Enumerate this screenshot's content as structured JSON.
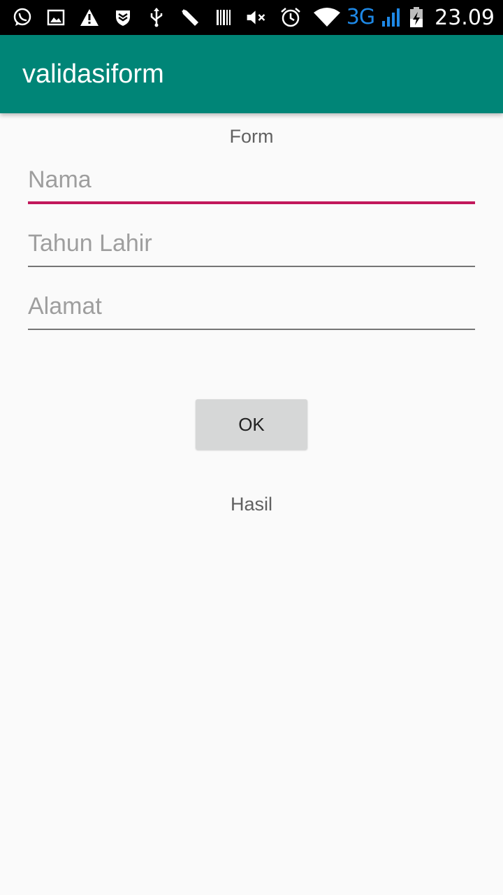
{
  "status_bar": {
    "time": "23.09",
    "network": "3G",
    "icons": [
      "whatsapp-icon",
      "image-icon",
      "warning-icon",
      "shield-icon",
      "usb-icon",
      "wrench-icon",
      "barcode-icon",
      "mute-icon",
      "alarm-icon",
      "wifi-icon",
      "signal-icon",
      "battery-charging-icon"
    ]
  },
  "app_bar": {
    "title": "validasiform",
    "color": "#008577"
  },
  "form": {
    "heading": "Form",
    "fields": [
      {
        "placeholder": "Nama",
        "value": "",
        "focused": true
      },
      {
        "placeholder": "Tahun Lahir",
        "value": ""
      },
      {
        "placeholder": "Alamat",
        "value": ""
      }
    ],
    "accent_color": "#c2185b",
    "button_label": "OK",
    "result_label": "Hasil"
  }
}
